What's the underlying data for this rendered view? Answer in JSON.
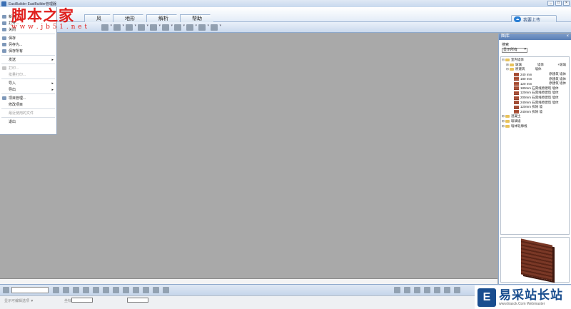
{
  "window": {
    "title": "EasiBuilder EasiBuilder管理器",
    "controls": [
      "_",
      "□",
      "×"
    ]
  },
  "watermark": {
    "main": "脚本之家",
    "url": "w w w . j b 5 1 . n e t"
  },
  "ribbon": {
    "tabs": [
      "风",
      "地形",
      "解析",
      "帮助"
    ],
    "upload_label": "我要上传"
  },
  "file_menu": {
    "items": [
      {
        "label": "新建",
        "icon": "new-icon",
        "disabled": false,
        "submenu": false
      },
      {
        "label": "打开...",
        "icon": "open-icon",
        "disabled": false,
        "submenu": false
      },
      {
        "label": "关闭",
        "icon": "close-file-icon",
        "disabled": false,
        "submenu": false
      },
      {
        "label": "保存",
        "icon": "save-icon",
        "disabled": false,
        "submenu": false
      },
      {
        "label": "另存为...",
        "icon": "save-as-icon",
        "disabled": false,
        "submenu": false
      },
      {
        "label": "保存所有",
        "icon": "save-all-icon",
        "disabled": false,
        "submenu": false
      },
      {
        "label": "发送",
        "icon": "",
        "disabled": false,
        "submenu": true
      },
      {
        "label": "打印...",
        "icon": "print-icon",
        "disabled": true,
        "submenu": false
      },
      {
        "label": "批量打印...",
        "icon": "",
        "disabled": true,
        "submenu": false
      },
      {
        "label": "导入",
        "icon": "",
        "disabled": false,
        "submenu": true
      },
      {
        "label": "导出",
        "icon": "",
        "disabled": false,
        "submenu": true
      },
      {
        "label": "项目管理...",
        "icon": "project-icon",
        "disabled": false,
        "submenu": false
      },
      {
        "label": "修改项目",
        "icon": "",
        "disabled": false,
        "submenu": false
      },
      {
        "label": "最近使用的文件",
        "icon": "",
        "disabled": true,
        "submenu": false
      },
      {
        "label": "退出",
        "icon": "",
        "disabled": false,
        "submenu": false
      }
    ]
  },
  "panel": {
    "title": "图库",
    "close": "×",
    "search_label": "搜索",
    "filter_value": "显示所有",
    "tree": [
      {
        "level": 0,
        "expander": "⊟",
        "kind": "folder",
        "label": "室内墙体",
        "col2": "",
        "col3": ""
      },
      {
        "level": 1,
        "expander": "⊞",
        "kind": "folder",
        "label": "玻璃",
        "col2": "墙体",
        "col3": "+玻璃"
      },
      {
        "level": 1,
        "expander": "⊟",
        "kind": "folder",
        "label": "原建筑",
        "col2": "墙体",
        "col3": ""
      },
      {
        "level": 2,
        "expander": "",
        "kind": "brick",
        "label": "240 mm",
        "col2": "",
        "col3": "原建筑 墙体"
      },
      {
        "level": 2,
        "expander": "",
        "kind": "brick",
        "label": "180 mm",
        "col2": "",
        "col3": "原建筑 墙体"
      },
      {
        "level": 2,
        "expander": "",
        "kind": "brick",
        "label": "120 mm",
        "col2": "",
        "col3": "原建筑 墙体"
      },
      {
        "level": 2,
        "expander": "",
        "kind": "brick",
        "label": "180mm 石膏线原建筑 墙体",
        "col2": "",
        "col3": ""
      },
      {
        "level": 2,
        "expander": "",
        "kind": "brick",
        "label": "120mm 石膏线原建筑 墙体",
        "col2": "",
        "col3": ""
      },
      {
        "level": 2,
        "expander": "",
        "kind": "brick",
        "label": "200mm 石膏线原建筑 墙体",
        "col2": "",
        "col3": ""
      },
      {
        "level": 2,
        "expander": "",
        "kind": "brick",
        "label": "240mm 石膏线原建筑 墙体",
        "col2": "",
        "col3": ""
      },
      {
        "level": 2,
        "expander": "",
        "kind": "brick",
        "label": "120mm 拆除 墙",
        "col2": "",
        "col3": ""
      },
      {
        "level": 2,
        "expander": "",
        "kind": "brick",
        "label": "240mm 拆除 墙",
        "col2": "",
        "col3": ""
      },
      {
        "level": 0,
        "expander": "⊞",
        "kind": "folder",
        "label": "混凝土",
        "col2": "",
        "col3": ""
      },
      {
        "level": 0,
        "expander": "⊞",
        "kind": "folder",
        "label": "玻璃墙",
        "col2": "",
        "col3": ""
      },
      {
        "level": 0,
        "expander": "⊞",
        "kind": "folder",
        "label": "墙体轮廓线",
        "col2": "",
        "col3": ""
      }
    ]
  },
  "statusbar": {
    "left_label": "显示可编辑选项 ▼",
    "coord_label": "坐标"
  },
  "site_logo": {
    "mark": "E",
    "name": "易采站长站",
    "url": "www.Easck.Com Webmaster"
  },
  "colors": {
    "canvas": "#a9a9a9",
    "accent": "#1a4e8f",
    "watermark": "#e0201e"
  }
}
